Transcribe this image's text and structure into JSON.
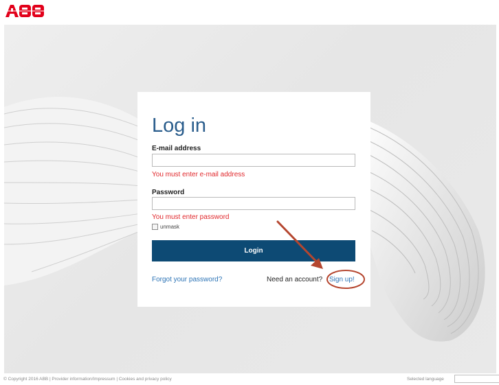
{
  "brand": {
    "logo_text": "ABB",
    "color": "#e2001a"
  },
  "login": {
    "title": "Log in",
    "email_label": "E-mail address",
    "email_value": "",
    "email_error": "You must enter e-mail address",
    "password_label": "Password",
    "password_value": "",
    "password_error": "You must enter password",
    "unmask_label": "unmask",
    "unmask_checked": false,
    "login_button": "Login",
    "forgot_link": "Forgot your password?",
    "need_account_text": "Need an account?",
    "signup_link": "Sign up!"
  },
  "footer": {
    "copyright": "© Copyright 2016 ABB | Provider information/Impressum | Cookies and privacy policy",
    "language_label": "Selected language",
    "language_value": ""
  },
  "colors": {
    "title": "#2a5d8c",
    "error": "#e0272b",
    "link": "#2a72b5",
    "button": "#0d4a74",
    "annotation": "#b5462f"
  }
}
